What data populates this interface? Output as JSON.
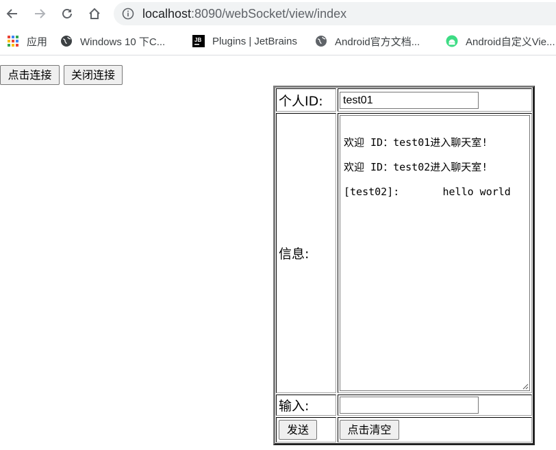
{
  "browser": {
    "url_host": "localhost",
    "url_path": ":8090/webSocket/view/index"
  },
  "bookmarks": [
    {
      "label": "应用",
      "icon": "apps-grid-icon"
    },
    {
      "label": "Windows 10 下C...",
      "icon": "globe-icon"
    },
    {
      "label": "Plugins | JetBrains",
      "icon": "jetbrains-icon"
    },
    {
      "label": "Android官方文档...",
      "icon": "globe-icon"
    },
    {
      "label": "Android自定义Vie...",
      "icon": "android-icon"
    }
  ],
  "page": {
    "connect_button": "点击连接",
    "disconnect_button": "关闭连接"
  },
  "form": {
    "id_label": "个人ID:",
    "id_value": "test01",
    "info_label": "信息:",
    "messages": [
      "欢迎 ID：test01进入聊天室!",
      "欢迎 ID：test02进入聊天室!",
      "[test02]:       hello world"
    ],
    "input_label": "输入:",
    "input_value": "",
    "send_button": "发送",
    "clear_button": "点击清空"
  },
  "colors": {
    "accent_grid_red": "#ea4335",
    "accent_grid_green": "#34a853",
    "accent_grid_blue": "#4285f4",
    "accent_grid_yellow": "#fbbc05",
    "android_green": "#3ddc84"
  }
}
